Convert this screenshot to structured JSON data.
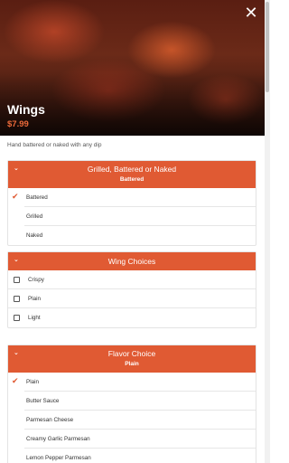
{
  "item": {
    "title": "Wings",
    "price": "$7.99",
    "description": "Hand battered or naked with any dip"
  },
  "icons": {
    "close": "close-icon",
    "chevron": "chevron-down-icon",
    "check": "check-icon",
    "checkbox": "checkbox-icon"
  },
  "colors": {
    "accent": "#e05a33",
    "price": "#ec6a3a"
  },
  "groups": [
    {
      "title": "Grilled, Battered or Naked",
      "selected": "Battered",
      "options": [
        "Battered",
        "Grilled",
        "Naked"
      ]
    },
    {
      "title": "Wing Choices",
      "options": [
        "Crispy",
        "Plain",
        "Light"
      ]
    },
    {
      "title": "Flavor Choice",
      "selected": "Plain",
      "options": [
        "Plain",
        "Butter Sauce",
        "Parmesan Cheese",
        "Creamy Garlic Parmesan",
        "Lemon Pepper Parmesan"
      ]
    }
  ]
}
